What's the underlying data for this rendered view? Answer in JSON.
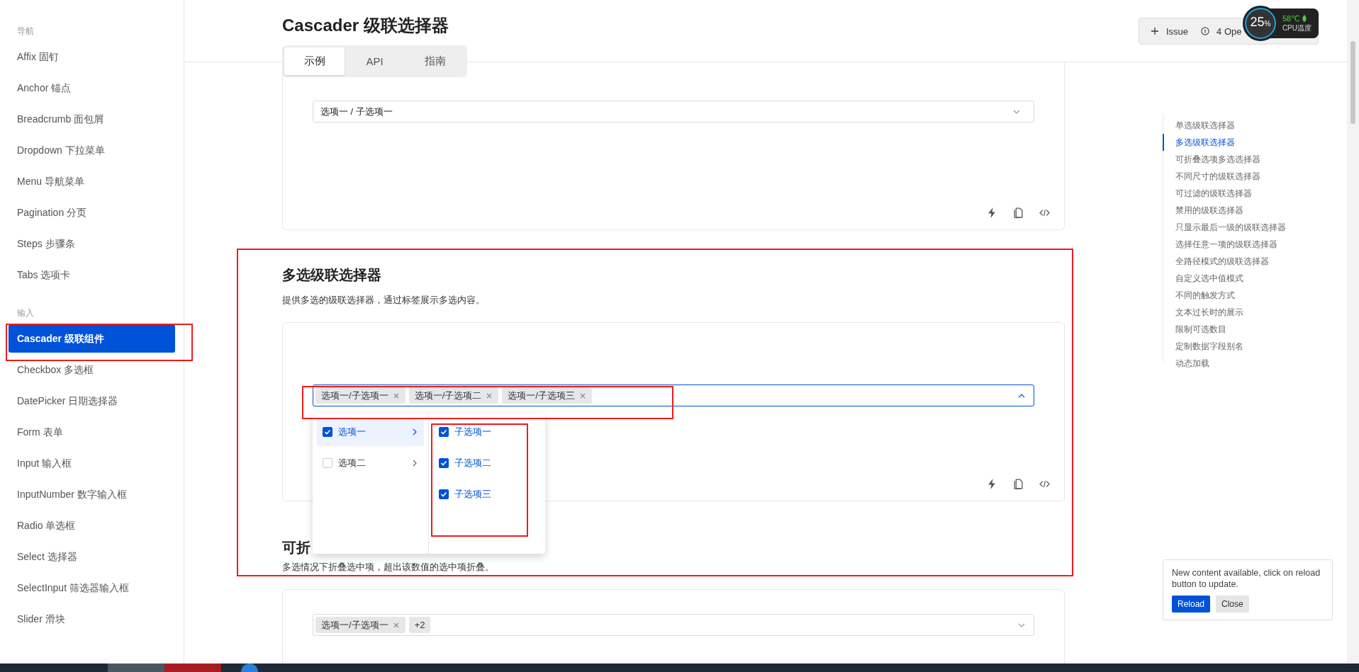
{
  "sidebar": {
    "groups": [
      {
        "title": "导航",
        "items": [
          {
            "label": "Affix 固钉",
            "selected": false
          },
          {
            "label": "Anchor 锚点",
            "selected": false
          },
          {
            "label": "Breadcrumb 面包屑",
            "selected": false
          },
          {
            "label": "Dropdown 下拉菜单",
            "selected": false
          },
          {
            "label": "Menu 导航菜单",
            "selected": false
          },
          {
            "label": "Pagination 分页",
            "selected": false
          },
          {
            "label": "Steps 步骤条",
            "selected": false
          },
          {
            "label": "Tabs 选项卡",
            "selected": false
          }
        ]
      },
      {
        "title": "输入",
        "items": [
          {
            "label": "Cascader 级联组件",
            "selected": true
          },
          {
            "label": "Checkbox 多选框",
            "selected": false
          },
          {
            "label": "DatePicker 日期选择器",
            "selected": false
          },
          {
            "label": "Form 表单",
            "selected": false
          },
          {
            "label": "Input 输入框",
            "selected": false
          },
          {
            "label": "InputNumber 数字输入框",
            "selected": false
          },
          {
            "label": "Radio 单选框",
            "selected": false
          },
          {
            "label": "Select 选择器",
            "selected": false
          },
          {
            "label": "SelectInput 筛选器输入框",
            "selected": false
          },
          {
            "label": "Slider 滑块",
            "selected": false
          }
        ]
      }
    ]
  },
  "header": {
    "title": "Cascader 级联选择器",
    "tabs": [
      {
        "label": "示例",
        "selected": true
      },
      {
        "label": "API",
        "selected": false
      },
      {
        "label": "指南",
        "selected": false
      }
    ],
    "issue_button": "Issue",
    "open_button": "4 Ope",
    "cpu_widget": {
      "value": "25",
      "unit": "%",
      "temperature": "58℃",
      "label": "CPU温度"
    }
  },
  "demos": [
    {
      "kind": "single",
      "value": "选项一 / 子选项一",
      "expanded": false
    },
    {
      "kind": "multiple",
      "title": "多选级联选择器",
      "description": "提供多选的级联选择器，通过标签展示多选内容。",
      "tags": [
        "选项一/子选项一",
        "选项一/子选项二",
        "选项一/子选项三"
      ],
      "expanded": true,
      "dropdown": [
        [
          {
            "label": "选项一",
            "checked": true,
            "selected": true,
            "has_children": true
          },
          {
            "label": "选项二",
            "checked": false,
            "selected": false,
            "has_children": true
          }
        ],
        [
          {
            "label": "子选项一",
            "checked": true,
            "selected": false,
            "has_children": false
          },
          {
            "label": "子选项二",
            "checked": true,
            "selected": false,
            "has_children": false
          },
          {
            "label": "子选项三",
            "checked": true,
            "selected": false,
            "has_children": false
          }
        ]
      ]
    },
    {
      "kind": "collapsed",
      "title": "可折",
      "description": "多选情况下折叠选中项，超出该数值的选中项折叠。",
      "tags": [
        "选项一/子选项一"
      ],
      "more": "+2",
      "expanded": false
    }
  ],
  "toc": [
    {
      "label": "单选级联选择器",
      "selected": false
    },
    {
      "label": "多选级联选择器",
      "selected": true
    },
    {
      "label": "可折叠选项多选选择器",
      "selected": false
    },
    {
      "label": "不同尺寸的级联选择器",
      "selected": false
    },
    {
      "label": "可过滤的级联选择器",
      "selected": false
    },
    {
      "label": "禁用的级联选择器",
      "selected": false
    },
    {
      "label": "只显示最后一级的级联选择器",
      "selected": false
    },
    {
      "label": "选择任意一项的级联选择器",
      "selected": false
    },
    {
      "label": "全路径模式的级联选择器",
      "selected": false
    },
    {
      "label": "自定义选中值模式",
      "selected": false
    },
    {
      "label": "不同的触发方式",
      "selected": false
    },
    {
      "label": "文本过长时的展示",
      "selected": false
    },
    {
      "label": "限制可选数目",
      "selected": false
    },
    {
      "label": "定制数据字段别名",
      "selected": false
    },
    {
      "label": "动态加载",
      "selected": false
    }
  ],
  "notification": {
    "message": "New content available, click on reload button to update.",
    "buttons": [
      {
        "label": "Reload",
        "kind": "primary"
      },
      {
        "label": "Close",
        "kind": "default"
      }
    ]
  }
}
